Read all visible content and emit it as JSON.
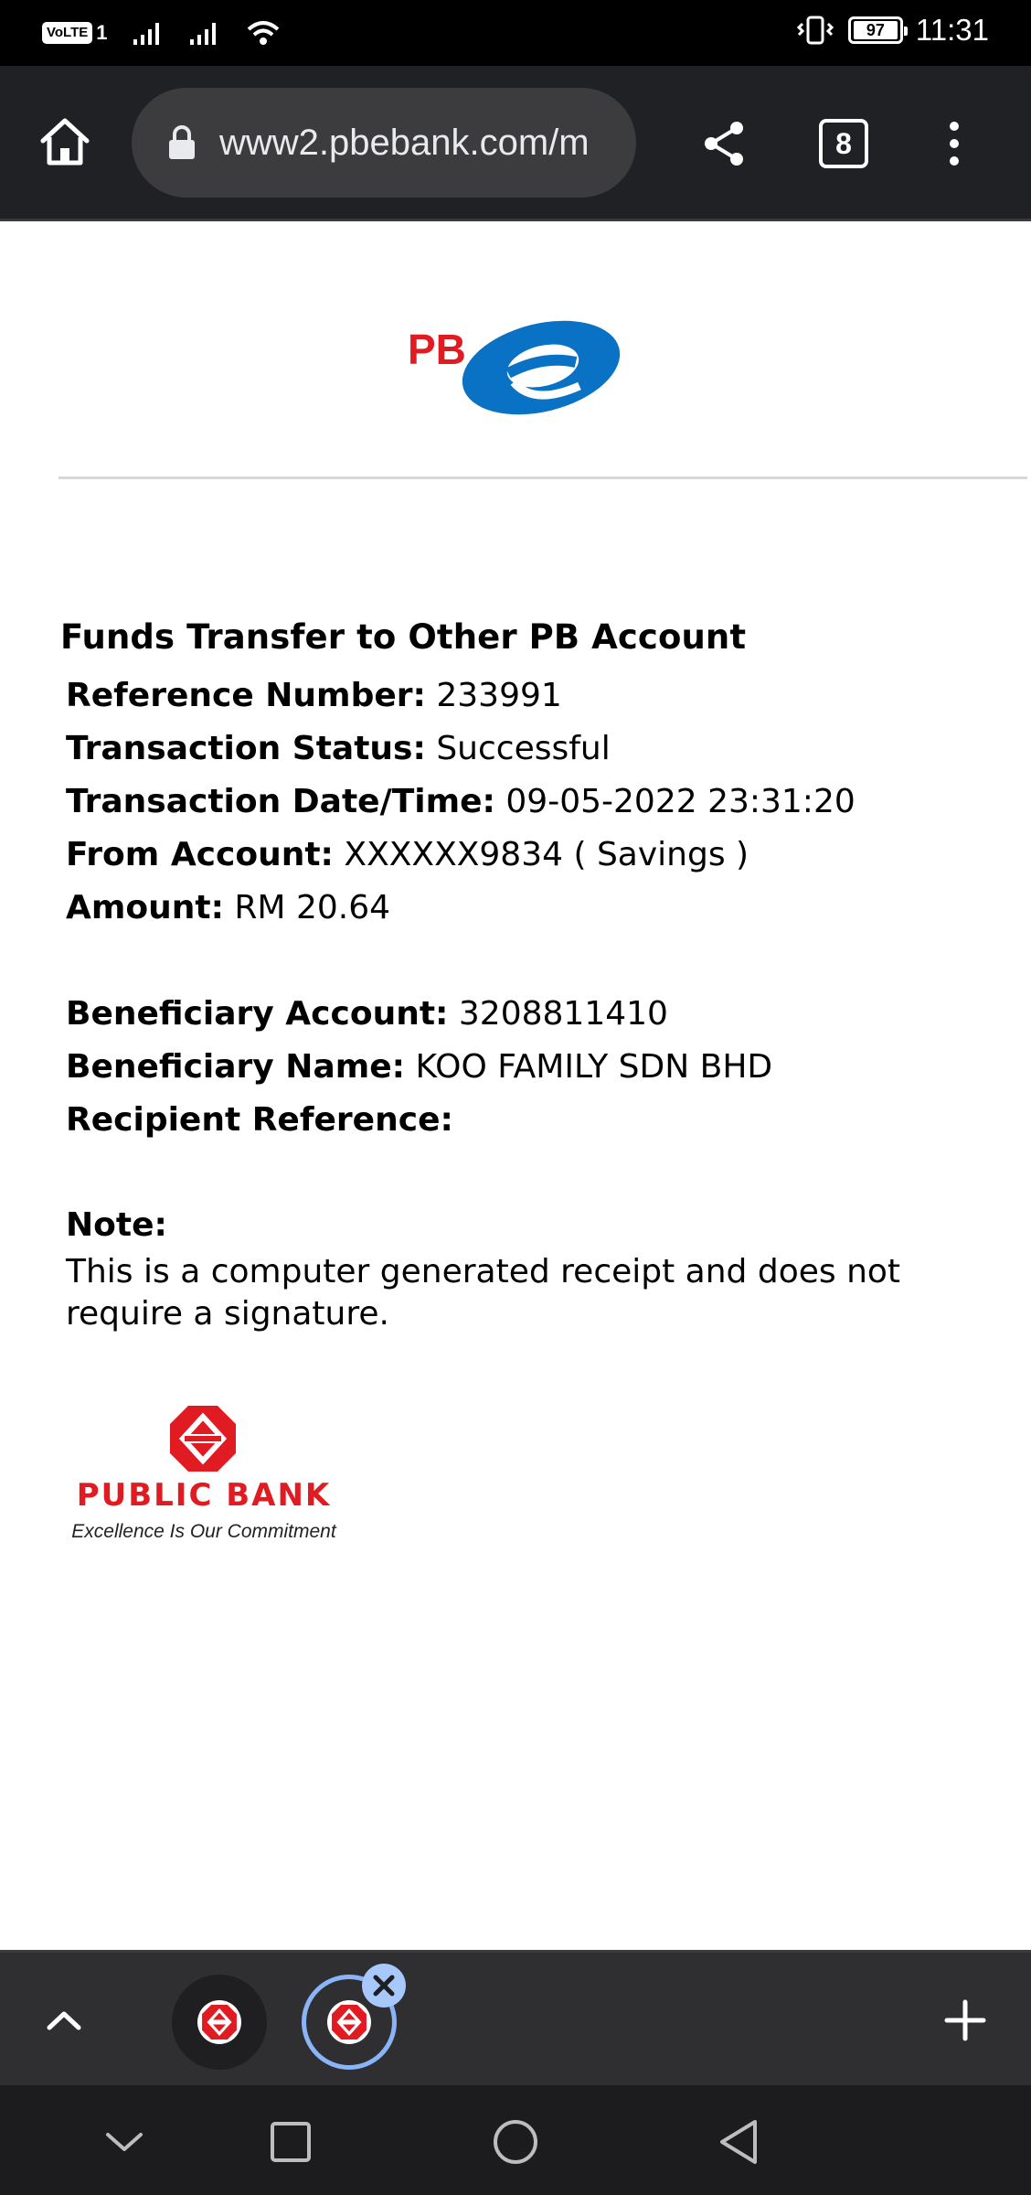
{
  "status_bar": {
    "volte_label": "VoLTE",
    "sim_label": "1",
    "battery_level": "97",
    "time": "11:31"
  },
  "browser": {
    "url": "www2.pbebank.com/m",
    "tab_count": "8",
    "icons": {
      "home": "home-icon",
      "lock": "lock-icon",
      "share": "share-icon",
      "menu": "more-vert-icon"
    }
  },
  "receipt": {
    "title": "Funds Transfer to Other PB Account",
    "fields": [
      {
        "label": "Reference Number:",
        "value": "233991"
      },
      {
        "label": "Transaction Status:",
        "value": "Successful"
      },
      {
        "label": "Transaction Date/Time:",
        "value": "09-05-2022 23:31:20"
      },
      {
        "label": "From Account:",
        "value": "XXXXXX9834 ( Savings )"
      },
      {
        "label": "Amount:",
        "value": "RM 20.64"
      }
    ],
    "beneficiary": [
      {
        "label": "Beneficiary Account:",
        "value": "3208811410"
      },
      {
        "label": "Beneficiary Name:",
        "value": "KOO FAMILY SDN BHD"
      },
      {
        "label": "Recipient Reference:",
        "value": ""
      }
    ],
    "note_label": "Note:",
    "note_text": "This is a computer generated receipt and does not require a signature."
  },
  "logos": {
    "pbe_text": "PB",
    "bank_name": "PUBLIC BANK",
    "tagline": "Excellence Is Our Commitment"
  },
  "colors": {
    "brand_red": "#e11b22",
    "brand_blue": "#0a72c4",
    "toolbar_bg": "#202124",
    "accent_blue": "#8ab4f8"
  }
}
